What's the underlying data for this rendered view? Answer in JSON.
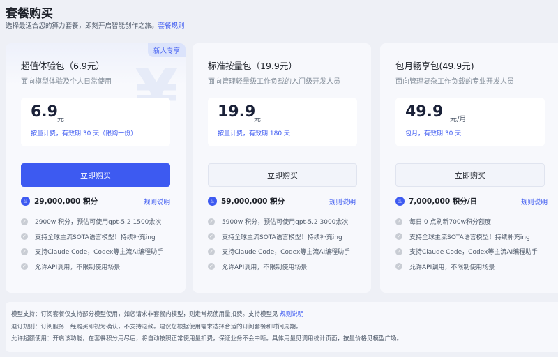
{
  "header": {
    "title": "套餐购买",
    "subtitle": "选择最适合您的算力套餐，即刻开启智能创作之旅。",
    "rules_link": "套餐规则"
  },
  "colors": {
    "accent": "#3d5af1"
  },
  "plans": [
    {
      "badge": "新人专享",
      "name": "超值体验包（6.9元）",
      "desc": "面向模型体验及个人日常使用",
      "price": "6.9",
      "unit": "元",
      "period": "按量计费，有效期 30 天（限购一份）",
      "buy": "立即购买",
      "points": "29,000,000 积分",
      "rule": "规则说明",
      "features": [
        "2900w 积分，预估可使用gpt-5.2 1500余次",
        "支持全球主流SOTA语言模型！持续补充ing",
        "支持Claude Code，Codex等主流AI编程助手",
        "允许API调用，不限制使用场景"
      ]
    },
    {
      "name": "标准按量包（19.9元）",
      "desc": "面向管理轻量级工作负载的入门级开发人员",
      "price": "19.9",
      "unit": "元",
      "period": "按量计费，有效期 180 天",
      "buy": "立即购买",
      "points": "59,000,000 积分",
      "rule": "规则说明",
      "features": [
        "5900w 积分，预估可使用gpt-5.2 3000余次",
        "支持全球主流SOTA语言模型！持续补充ing",
        "支持Claude Code，Codex等主流AI编程助手",
        "允许API调用，不限制使用场景"
      ]
    },
    {
      "name": "包月畅享包(49.9元)",
      "desc": "面向管理复杂工作负载的专业开发人员",
      "price": "49.9",
      "unit": "元/月",
      "period": "包月，有效期 30 天",
      "buy": "立即购买",
      "points": "7,000,000 积分/日",
      "rule": "规则说明",
      "features": [
        "每日 0 点刷新700w积分额度",
        "支持全球主流SOTA语言模型！持续补充ing",
        "支持Claude Code，Codex等主流AI编程助手",
        "允许API调用，不限制使用场景"
      ]
    }
  ],
  "notes": {
    "model_support": "模型支持：订阅套餐仅支持部分模型使用，如您请求非套餐内模型，则走常规使用量扣费。支持模型见",
    "model_link": "规则说明",
    "refund": "退订规则：订阅服务一经购买即视为确认，不支持退款。建议您根据使用需求选择合适的订阅套餐和时间周期。",
    "overage": "允许超额使用：开启该功能，在套餐积分用尽后，将自动按照正常使用量扣费，保证业务不会中断。具体用量见调用统计页面，按量价格见模型广场。"
  }
}
